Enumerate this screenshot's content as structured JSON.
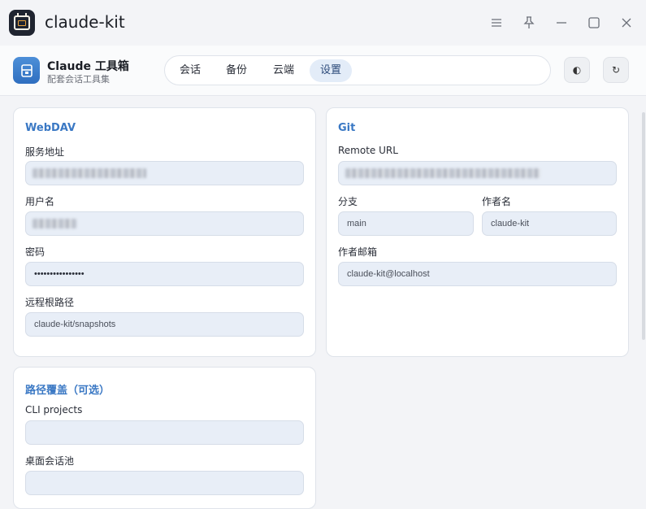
{
  "window": {
    "title": "claude-kit"
  },
  "header": {
    "brand_title": "Claude 工具箱",
    "brand_subtitle": "配套会话工具集",
    "tabs": [
      {
        "label": "会话",
        "active": false
      },
      {
        "label": "备份",
        "active": false
      },
      {
        "label": "云端",
        "active": false
      },
      {
        "label": "设置",
        "active": true
      }
    ],
    "theme_button_icon": "◐",
    "refresh_button_icon": "↻"
  },
  "webdav": {
    "title": "WebDAV",
    "server_label": "服务地址",
    "username_label": "用户名",
    "password_label": "密码",
    "password_value": "••••••••••••••••",
    "remote_root_label": "远程根路径",
    "remote_root_value": "claude-kit/snapshots"
  },
  "git": {
    "title": "Git",
    "remote_url_label": "Remote URL",
    "branch_label": "分支",
    "branch_value": "main",
    "author_name_label": "作者名",
    "author_name_value": "claude-kit",
    "author_email_label": "作者邮箱",
    "author_email_value": "claude-kit@localhost"
  },
  "path_override": {
    "title": "路径覆盖（可选）",
    "cli_projects_label": "CLI projects",
    "cli_projects_value": "",
    "desktop_pool_label": "桌面会话池",
    "desktop_pool_value": ""
  },
  "colors": {
    "accent": "#3a78c4",
    "field_bg": "#e8eef7",
    "active_tab_bg": "#e3ecf8"
  }
}
